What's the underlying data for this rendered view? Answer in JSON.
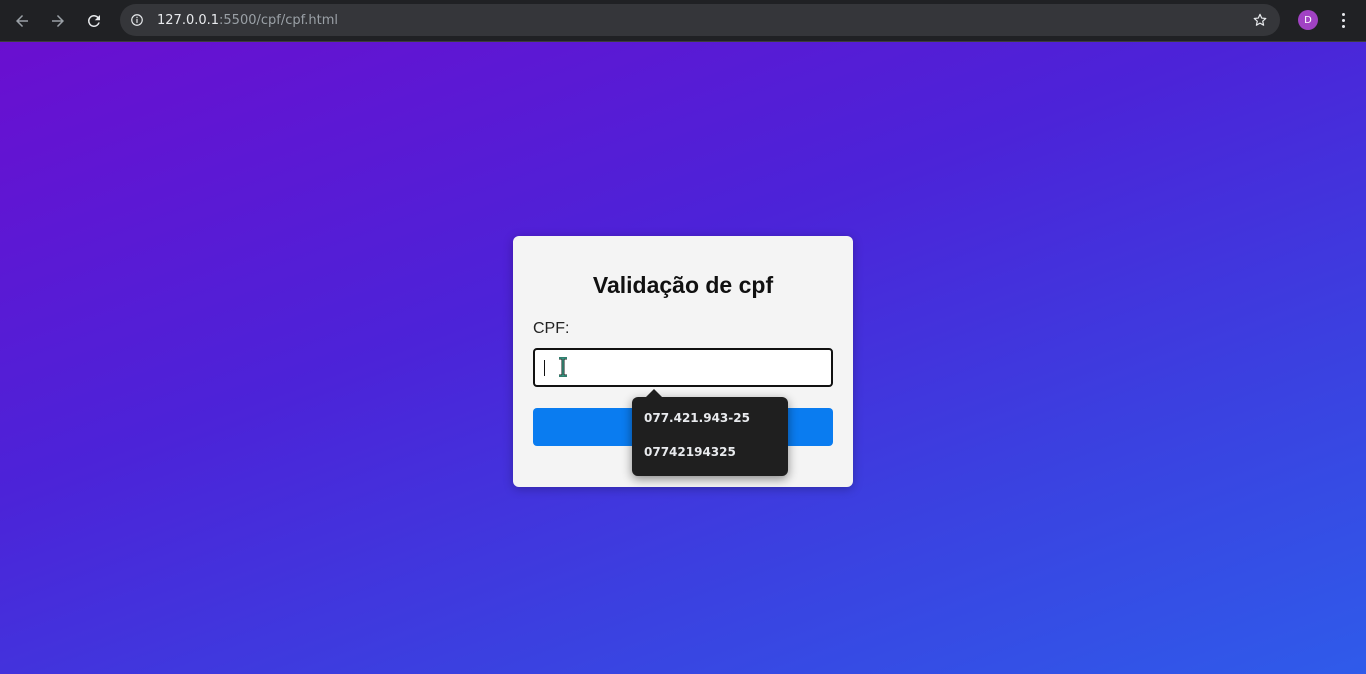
{
  "browser": {
    "url_host": "127.0.0.1",
    "url_path": ":5500/cpf/cpf.html",
    "profile_initial": "D",
    "icons": {
      "back": "arrow-left-icon",
      "forward": "arrow-right-icon",
      "reload": "reload-icon",
      "site_info": "info-icon",
      "bookmark": "star-icon",
      "menu": "kebab-menu-icon"
    },
    "colors": {
      "toolbar": "#202124",
      "omnibox": "#35363a",
      "avatar": "#a142c4"
    }
  },
  "page": {
    "title": "Validação de cpf",
    "cpf_label": "CPF:",
    "cpf_value": "",
    "validate_label": "",
    "colors": {
      "gradient_start": "#6a0fd0",
      "gradient_end": "#2f5bea",
      "card": "#f4f4f4",
      "button": "#0a7cf0"
    }
  },
  "autocomplete": {
    "suggestions": [
      "077.421.943-25",
      "07742194325"
    ]
  }
}
